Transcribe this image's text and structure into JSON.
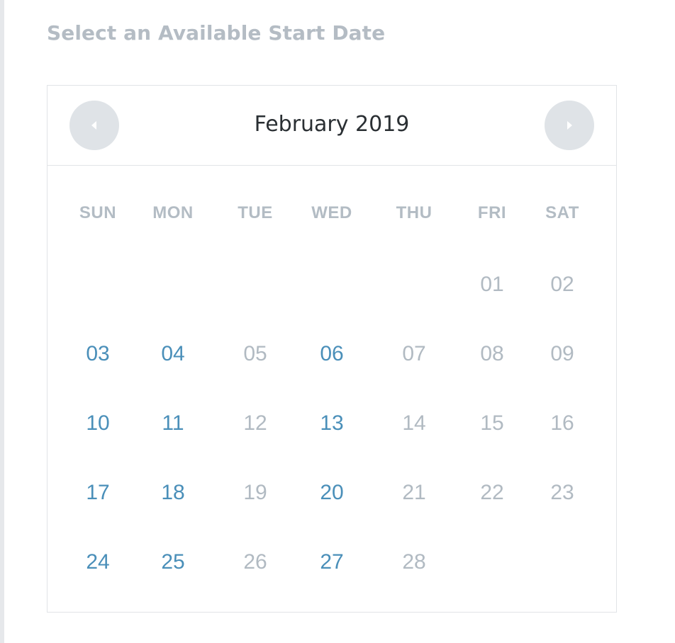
{
  "heading": "Select an Available Start Date",
  "calendar": {
    "month_label": "February 2019",
    "prev_icon": "caret-left-icon",
    "next_icon": "caret-right-icon",
    "weekdays": [
      "SUN",
      "MON",
      "TUE",
      "WED",
      "THU",
      "FRI",
      "SAT"
    ],
    "weeks": [
      [
        {
          "day": "",
          "available": false
        },
        {
          "day": "",
          "available": false
        },
        {
          "day": "",
          "available": false
        },
        {
          "day": "",
          "available": false
        },
        {
          "day": "",
          "available": false
        },
        {
          "day": "01",
          "available": false
        },
        {
          "day": "02",
          "available": false
        }
      ],
      [
        {
          "day": "03",
          "available": true
        },
        {
          "day": "04",
          "available": true
        },
        {
          "day": "05",
          "available": false
        },
        {
          "day": "06",
          "available": true
        },
        {
          "day": "07",
          "available": false
        },
        {
          "day": "08",
          "available": false
        },
        {
          "day": "09",
          "available": false
        }
      ],
      [
        {
          "day": "10",
          "available": true
        },
        {
          "day": "11",
          "available": true
        },
        {
          "day": "12",
          "available": false
        },
        {
          "day": "13",
          "available": true
        },
        {
          "day": "14",
          "available": false
        },
        {
          "day": "15",
          "available": false
        },
        {
          "day": "16",
          "available": false
        }
      ],
      [
        {
          "day": "17",
          "available": true
        },
        {
          "day": "18",
          "available": true
        },
        {
          "day": "19",
          "available": false
        },
        {
          "day": "20",
          "available": true
        },
        {
          "day": "21",
          "available": false
        },
        {
          "day": "22",
          "available": false
        },
        {
          "day": "23",
          "available": false
        }
      ],
      [
        {
          "day": "24",
          "available": true
        },
        {
          "day": "25",
          "available": true
        },
        {
          "day": "26",
          "available": false
        },
        {
          "day": "27",
          "available": true
        },
        {
          "day": "28",
          "available": false
        },
        {
          "day": "",
          "available": false
        },
        {
          "day": "",
          "available": false
        }
      ]
    ]
  },
  "colors": {
    "available_day": "#4a8fb9",
    "unavailable_day": "#b1bac2",
    "heading": "#b4bcc4",
    "nav_button": "#dfe3e7",
    "border": "#e1e4e7"
  }
}
